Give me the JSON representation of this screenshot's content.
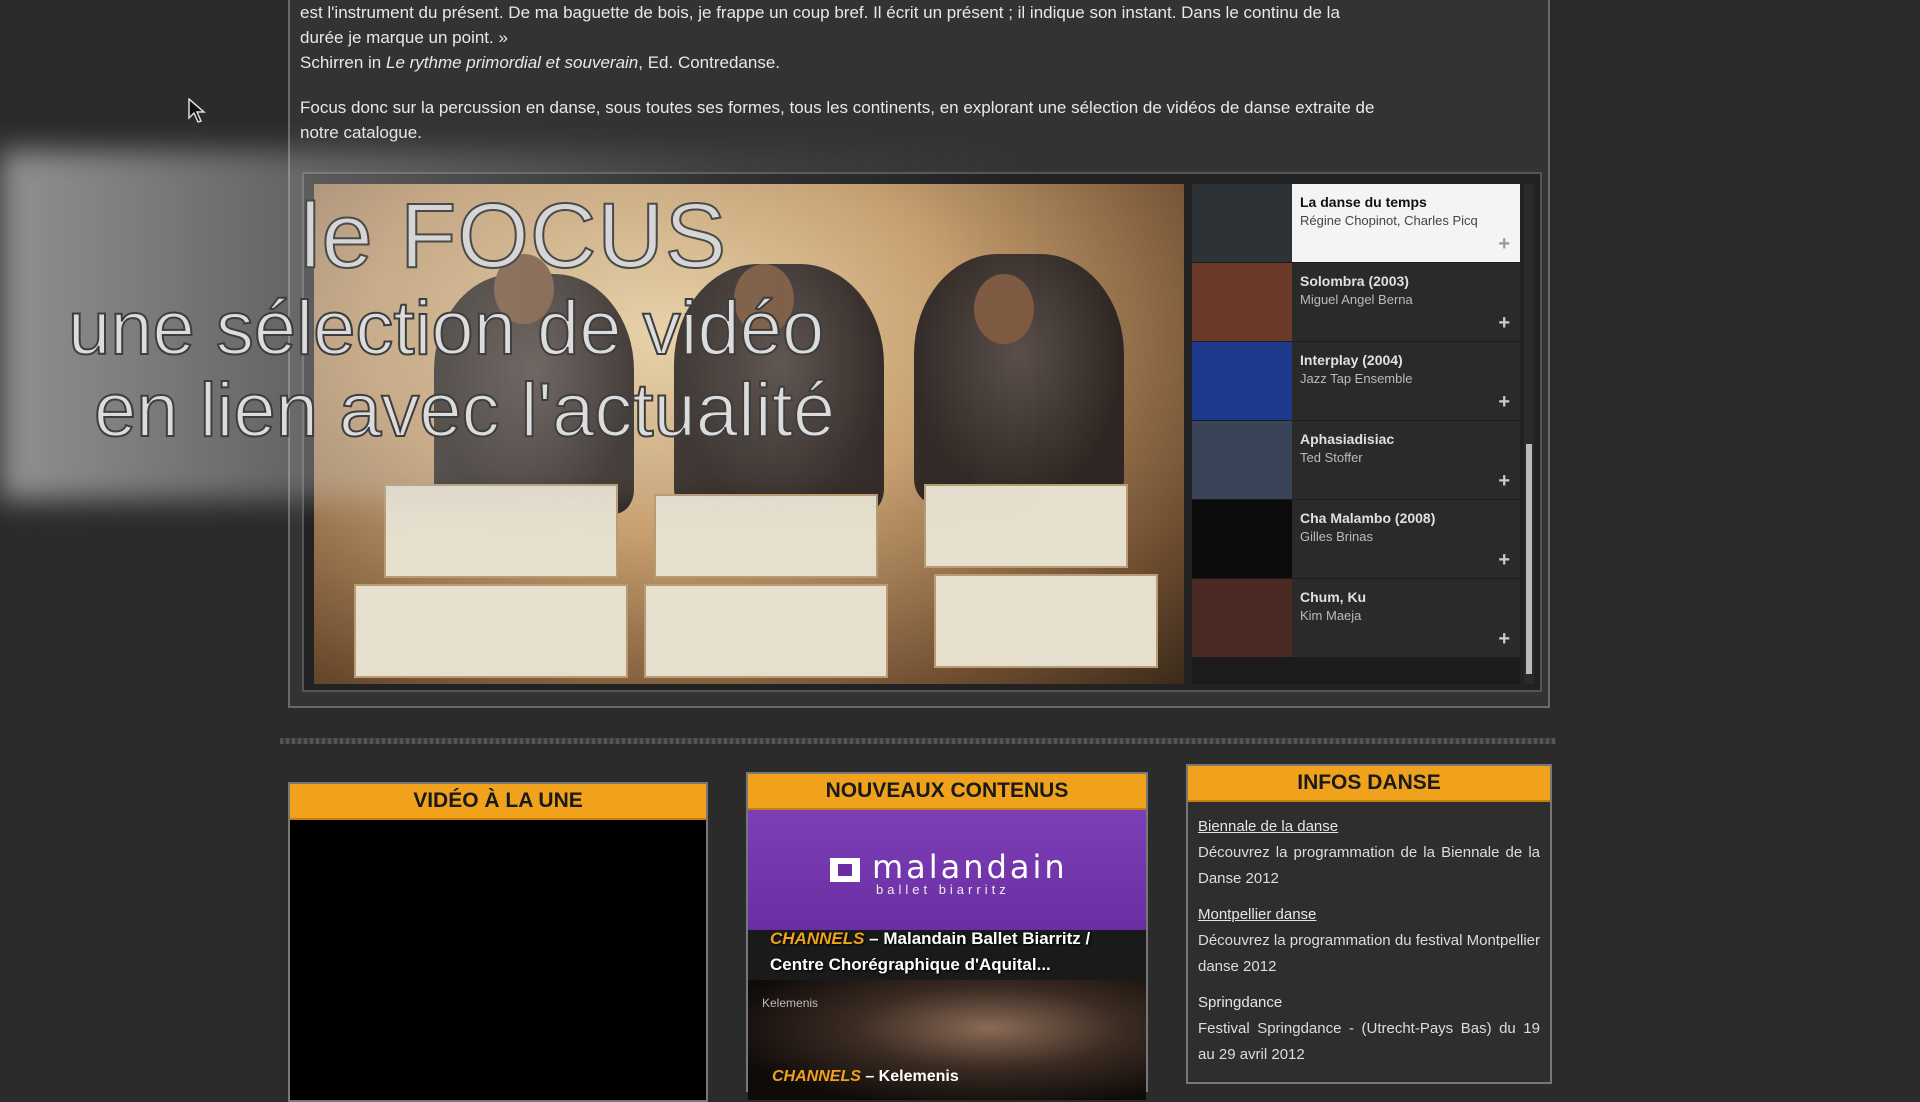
{
  "intro": {
    "quote_line1": "est l'instrument du présent. De ma baguette de bois, je frappe un coup bref. Il écrit un présent ; il indique son instant. Dans le continu de la",
    "quote_line2": "durée je marque un point. »",
    "source_prefix": "Schirren in ",
    "source_title": "Le rythme primordial et souverain",
    "source_suffix": ", Ed. Contredanse.",
    "focus_text": "Focus donc sur la percussion en danse, sous toutes ses formes, tous les continents, en explorant une sélection de vidéos de danse extraite de",
    "focus_link": "notre catalogue."
  },
  "overlay": {
    "title": "le FOCUS",
    "line1": "une sélection de vidéo",
    "line2": "en lien avec l'actualité"
  },
  "playlist": [
    {
      "title": "La danse du temps",
      "author": "Régine Chopinot, Charles Picq",
      "thumb": "#2d3236",
      "selected": true
    },
    {
      "title": "Solombra (2003)",
      "author": "Miguel Angel Berna",
      "thumb": "#6b3a2a",
      "selected": false
    },
    {
      "title": "Interplay (2004)",
      "author": "Jazz Tap Ensemble",
      "thumb": "#1e3a8c",
      "selected": false
    },
    {
      "title": "Aphasiadisiac",
      "author": "Ted Stoffer",
      "thumb": "#3a4458",
      "selected": false
    },
    {
      "title": "Cha Malambo (2008)",
      "author": "Gilles Brinas",
      "thumb": "#0c0c0c",
      "selected": false
    },
    {
      "title": "Chum, Ku",
      "author": "Kim Maeja",
      "thumb": "#4a2a22",
      "selected": false
    }
  ],
  "playlist_plus": "+",
  "boxes": {
    "video_header": "VIDÉO À LA UNE",
    "new_header": "NOUVEAUX CONTENUS",
    "infos_header": "INFOS DANSE"
  },
  "new_content": {
    "brand": "malandain",
    "brand_sub": "ballet biarritz",
    "channels_label": "CHANNELS",
    "caption_rest": " – Malandain Ballet Biarritz /",
    "caption_line2": "Centre Chorégraphique d'Aquital...",
    "small_label": "Kelemenis",
    "caption2_rest": " – Kelemenis"
  },
  "infos": [
    {
      "title": "Biennale de la danse",
      "desc": "Découvrez la programmation de la Biennale de la Danse 2012",
      "linked": true
    },
    {
      "title": "Montpellier danse",
      "desc": "Découvrez la programmation du festival Montpellier danse 2012",
      "linked": true
    },
    {
      "title": "Springdance",
      "desc": "Festival Springdance - (Utrecht-Pays Bas) du 19 au 29 avril 2012",
      "linked": false
    }
  ],
  "colors": {
    "accent_orange": "#f0a21c",
    "brand_purple": "#6a2ea2",
    "background": "#2b2b2b"
  }
}
